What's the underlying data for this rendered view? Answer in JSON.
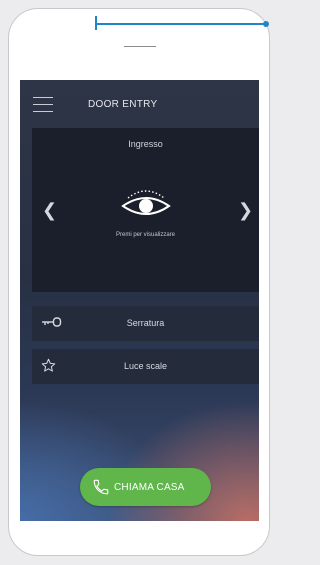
{
  "header": {
    "title": "DOOR ENTRY",
    "menu_icon": "hamburger-menu-icon"
  },
  "camera": {
    "label": "Ingresso",
    "hint": "Premi per visualizzare",
    "prev_icon": "chevron-left-icon",
    "next_icon": "chevron-right-icon",
    "view_icon": "eye-icon"
  },
  "actions": [
    {
      "label": "Serratura",
      "icon": "key-icon"
    },
    {
      "label": "Luce scale",
      "icon": "star-icon"
    }
  ],
  "call_button": {
    "label": "CHIAMA CASA",
    "icon": "phone-icon",
    "color": "#60b64a"
  },
  "colors": {
    "pointer": "#1f87c8",
    "screen_bg": "#2d3546"
  }
}
